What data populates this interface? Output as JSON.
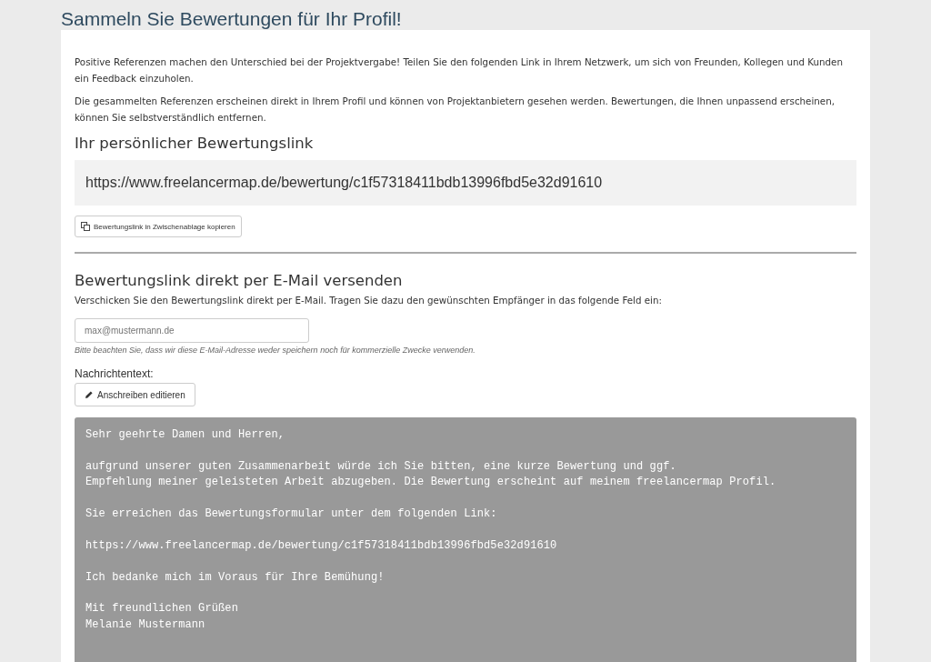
{
  "page_title": "Sammeln Sie Bewertungen für Ihr Profil!",
  "intro": [
    "Positive Referenzen machen den Unterschied bei der Projektvergabe! Teilen Sie den folgenden Link in Ihrem Netzwerk, um sich von Freunden, Kollegen und Kunden ein Feedback einzuholen.",
    "Die gesammelten Referenzen erscheinen direkt in Ihrem Profil und können von Projektanbietern gesehen werden. Bewertungen, die Ihnen unpassend erscheinen, können Sie selbstverständlich entfernen."
  ],
  "link_section": {
    "heading": "Ihr persönlicher Bewertungslink",
    "link": "https://www.freelancermap.de/bewertung/c1f57318411bdb13996fbd5e32d91610",
    "copy_button": "Bewertungslink in Zwischenablage kopieren"
  },
  "email_section": {
    "heading": "Bewertungslink direkt per E-Mail versenden",
    "description": "Verschicken Sie den Bewertungslink direkt per E-Mail. Tragen Sie dazu den gewünschten Empfänger in das folgende Feld ein:",
    "email_field": {
      "placeholder": "max@mustermann.de"
    },
    "note": "Bitte beachten Sie, dass wir diese E-Mail-Adresse weder speichern noch für kommerzielle Zwecke verwenden.",
    "message_label": "Nachrichtentext:",
    "edit_button": "Anschreiben editieren",
    "message": [
      [
        "Sehr geehrte Damen und Herren,"
      ],
      [
        "aufgrund unserer guten Zusammenarbeit würde ich Sie bitten, eine kurze Bewertung und ggf.",
        "Empfehlung meiner geleisteten Arbeit abzugeben. Die Bewertung erscheint auf meinem freelancermap Profil."
      ],
      [
        "Sie erreichen das Bewertungsformular unter dem folgenden Link:"
      ],
      [
        "https://www.freelancermap.de/bewertung/c1f57318411bdb13996fbd5e32d91610"
      ],
      [
        "Ich bedanke mich im Voraus für Ihre Bemühung!"
      ],
      [
        "Mit freundlichen Grüßen",
        "Melanie Mustermann"
      ]
    ]
  }
}
